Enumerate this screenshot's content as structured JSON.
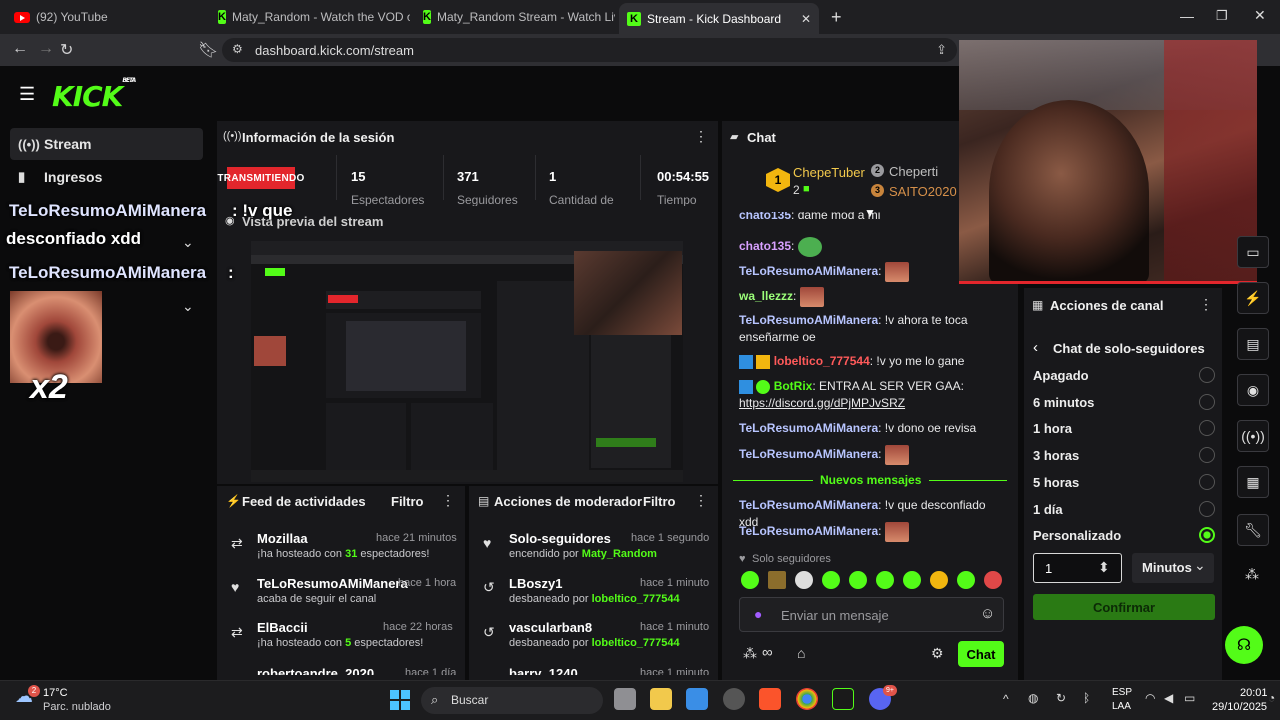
{
  "browser": {
    "tabs": [
      {
        "title": "(92) YouTube"
      },
      {
        "title": "Maty_Random - Watch the VOD on K"
      },
      {
        "title": "Maty_Random Stream - Watch Live o"
      },
      {
        "title": "Stream - Kick Dashboard"
      }
    ],
    "url": "dashboard.kick.com/stream"
  },
  "brand": {
    "logo": "KICK",
    "beta": "BETA",
    "accent": "#53fc18"
  },
  "sidebar": {
    "items": [
      {
        "label": "Stream"
      },
      {
        "label": "Ingresos"
      }
    ]
  },
  "session": {
    "title": "Información de la sesión",
    "live_badge": "TRANSMITIENDO",
    "stats": [
      {
        "value": "15",
        "label": "Espectadores"
      },
      {
        "value": "371",
        "label": "Seguidores"
      },
      {
        "value": "1",
        "label": "Cantidad de"
      },
      {
        "value": "00:54:55",
        "label": "Tiempo"
      }
    ]
  },
  "preview": {
    "title": "Vista previa del stream"
  },
  "overlay": {
    "line1_user": "TeLoResumoAMiManera",
    "line1_msg": ": !v que",
    "line1_msg2": "desconfiado xdd",
    "line2_user": "TeLoResumoAMiManera",
    "line2_msg": " :",
    "emote_tag": "x2"
  },
  "feed": {
    "title": "Feed de actividades",
    "filter": "Filtro",
    "items": [
      {
        "name": "Mozillaa",
        "time": "hace 21 minutos",
        "sub_pre": "¡ha hosteado con ",
        "sub_hl": "31",
        "sub_post": " espectadores!"
      },
      {
        "name": "TeLoResumoAMiManera",
        "time": "hace 1 hora",
        "sub_pre": "acaba de seguir el canal",
        "sub_hl": "",
        "sub_post": ""
      },
      {
        "name": "ElBaccii",
        "time": "hace 22 horas",
        "sub_pre": "¡ha hosteado con ",
        "sub_hl": "5",
        "sub_post": " espectadores!"
      },
      {
        "name": "robertoandre_2020",
        "time": "hace 1 día"
      }
    ]
  },
  "mod": {
    "title": "Acciones de moderador",
    "filter": "Filtro",
    "items": [
      {
        "name": "Solo-seguidores",
        "time": "hace 1 segundo",
        "sub_pre": "encendido por ",
        "sub_hl": "Maty_Random"
      },
      {
        "name": "LBoszy1",
        "time": "hace 1 minuto",
        "sub_pre": "desbaneado por ",
        "sub_hl": "lobeltico_777544"
      },
      {
        "name": "vascularban8",
        "time": "hace 1 minuto",
        "sub_pre": "desbaneado por ",
        "sub_hl": "lobeltico_777544"
      },
      {
        "name": "barry_1240",
        "time": "hace 1 minuto"
      }
    ]
  },
  "chat": {
    "title": "Chat",
    "top": [
      {
        "rank": "1",
        "name": "ChepeTuber",
        "count": "2"
      },
      {
        "rank": "2",
        "name": "Cheperti"
      },
      {
        "rank": "3",
        "name": "SAITO2020"
      }
    ],
    "messages": [
      {
        "user": "chato135",
        "text": ": dame mod a mi"
      },
      {
        "user": "chato135",
        "text": ":"
      },
      {
        "user": "TeLoResumoAMiManera",
        "text": ":"
      },
      {
        "user": "wa_llezzz",
        "text": ":"
      },
      {
        "user": "TeLoResumoAMiManera",
        "text": ": !v ahora te toca enseñarme oe"
      },
      {
        "user": "lobeltico_777544",
        "text": ": !v yo me lo gane"
      },
      {
        "user": "BotRix",
        "text": ": ENTRA AL SER VER GAA: ",
        "link": "https://discord.gg/dPjMPJvSRZ"
      },
      {
        "user": "TeLoResumoAMiManera",
        "text": ": !v dono oe revisa"
      },
      {
        "user": "TeLoResumoAMiManera",
        "text": ":"
      },
      {
        "user": "TeLoResumoAMiManera",
        "text": ": !v que desconfiado xdd"
      },
      {
        "user": "TeLoResumoAMiManera",
        "text": ":"
      }
    ],
    "new_messages": "Nuevos mensajes",
    "mode": "Solo seguidores",
    "placeholder": "Enviar un mensaje",
    "send": "Chat"
  },
  "channel_actions": {
    "title": "Acciones de canal",
    "subtitle": "Chat de solo-seguidores",
    "options": [
      {
        "label": "Apagado",
        "selected": false
      },
      {
        "label": "6 minutos",
        "selected": false
      },
      {
        "label": "1 hora",
        "selected": false
      },
      {
        "label": "3 horas",
        "selected": false
      },
      {
        "label": "5 horas",
        "selected": false
      },
      {
        "label": "1 día",
        "selected": false
      },
      {
        "label": "Personalizado",
        "selected": true
      }
    ],
    "custom_value": "1",
    "unit": "Minutos",
    "confirm": "Confirmar"
  },
  "taskbar": {
    "weather_temp": "17°C",
    "weather_desc": "Parc. nublado",
    "search": "Buscar",
    "lang1": "ESP",
    "lang2": "LAA",
    "time": "20:01",
    "date": "29/10/2025",
    "weather_badge": "2",
    "discord_badge": "9+"
  }
}
